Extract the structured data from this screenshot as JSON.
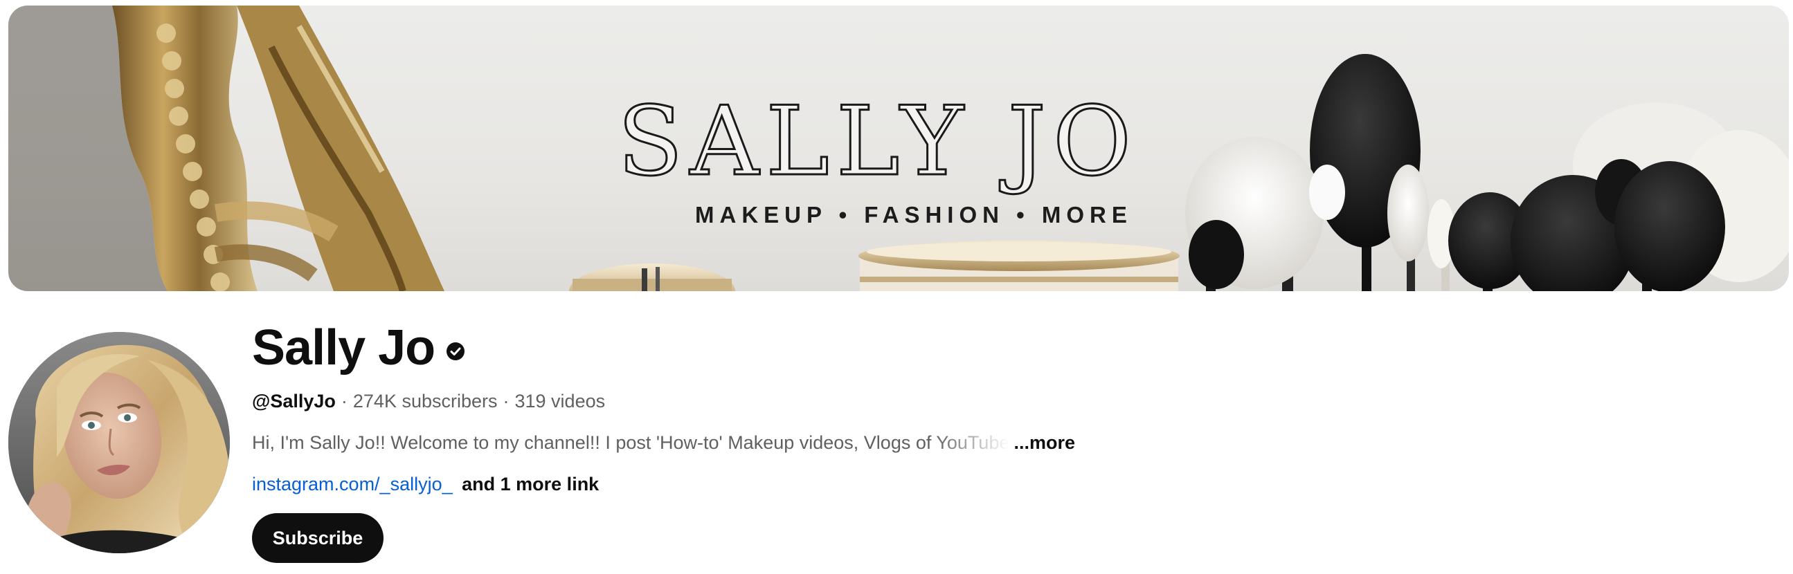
{
  "banner": {
    "title": "SALLY JO",
    "tagline": "MAKEUP • FASHION • MORE"
  },
  "channel": {
    "name": "Sally Jo",
    "handle": "@SallyJo",
    "separator": "·",
    "subscribers": "274K subscribers",
    "videos": "319 videos",
    "description": "Hi, I'm Sally Jo!! Welcome to my channel!! I post 'How-to' Makeup videos, Vlogs of YouTube",
    "more_label": "...more",
    "link_primary": "instagram.com/_sallyjo_",
    "link_more": "and 1 more link",
    "subscribe_label": "Subscribe"
  },
  "icons": {
    "verified": "verified-check-icon"
  },
  "colors": {
    "link": "#065fd4",
    "subscribe_bg": "#0f0f0f",
    "secondary_text": "#606060"
  }
}
